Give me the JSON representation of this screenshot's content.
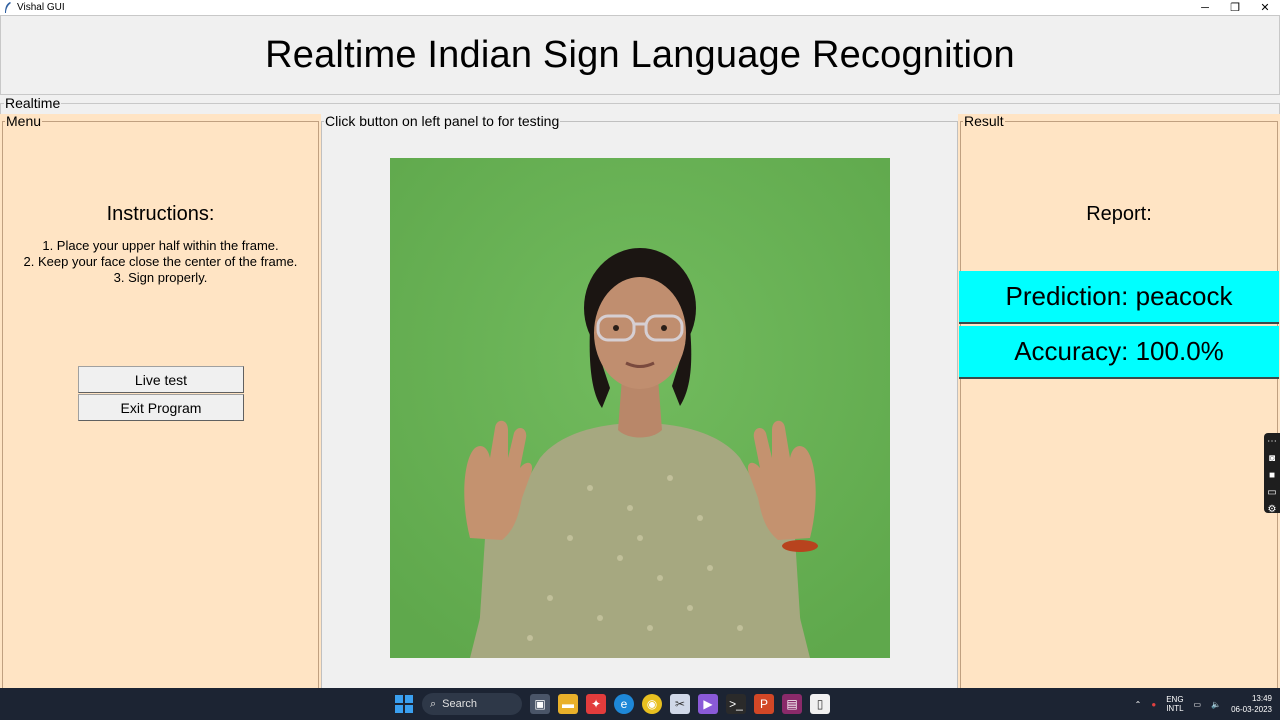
{
  "window": {
    "title": "Vishal GUI",
    "controls": {
      "minimize": "─",
      "restore": "❐",
      "close": "✕"
    }
  },
  "header": {
    "title": "Realtime Indian Sign Language Recognition"
  },
  "realtime_frame": {
    "label": "Realtime"
  },
  "menu": {
    "label": "Menu",
    "instructions_title": "Instructions:",
    "instructions": [
      "1. Place your upper half within the frame.",
      "2. Keep your face close the center of the frame.",
      "3. Sign properly."
    ],
    "live_test_label": "Live test",
    "exit_label": "Exit Program"
  },
  "center": {
    "label": "Click button on left panel to for testing",
    "image_description": "video-frame-person-signing"
  },
  "result": {
    "label": "Result",
    "report_title": "Report:",
    "prediction": "Prediction: peacock",
    "accuracy": "Accuracy: 100.0%"
  },
  "colors": {
    "panel_bg": "#ffe4c4",
    "result_highlight": "#00ffff",
    "green_screen": "#68b254",
    "taskbar": "#1c2433"
  },
  "taskbar": {
    "search_label": "Search",
    "lang_top": "ENG",
    "lang_bottom": "INTL",
    "time": "13:49",
    "date": "06-03-2023"
  }
}
